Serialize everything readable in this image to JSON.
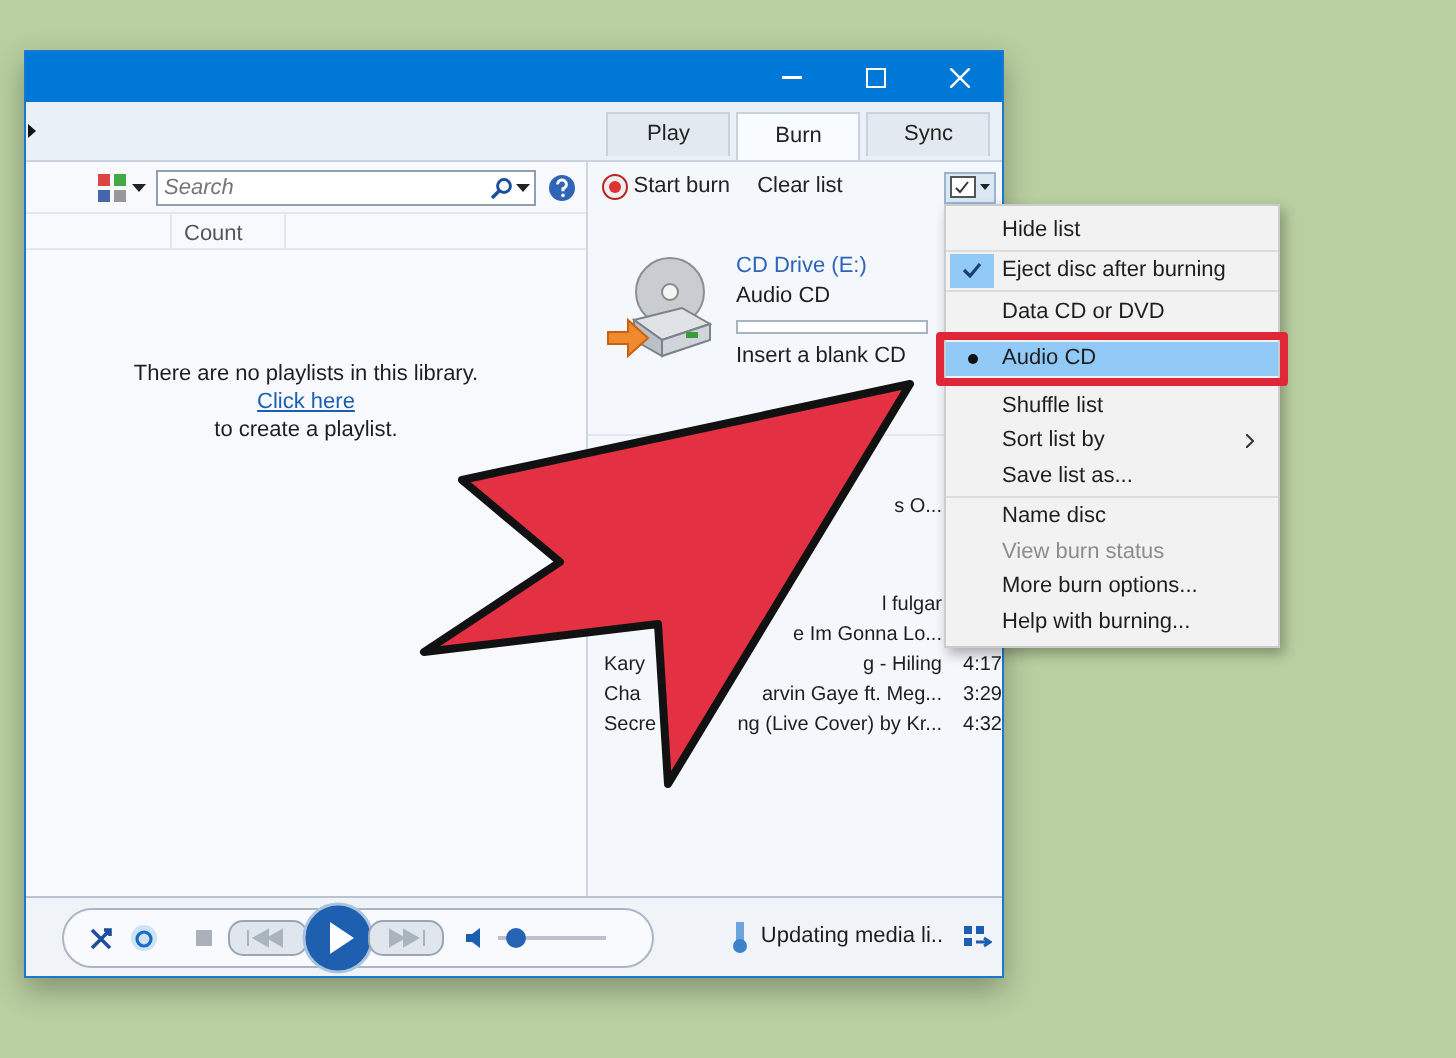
{
  "tabs": [
    {
      "label": "Play",
      "selected": false
    },
    {
      "label": "Burn",
      "selected": true
    },
    {
      "label": "Sync",
      "selected": false
    }
  ],
  "search": {
    "placeholder": "Search"
  },
  "library": {
    "columns": [
      "Count"
    ],
    "message": "There are no playlists in this library.",
    "link": "Click here",
    "after_link": "to create a playlist."
  },
  "burn_toolbar": {
    "start": "Start burn",
    "clear": "Clear list"
  },
  "drive": {
    "name": "CD Drive (E:)",
    "type": "Audio CD",
    "level": 0,
    "hint": "Insert a blank CD"
  },
  "tracks": [
    {
      "end": "s O..."
    },
    {
      "end": "l fulgar"
    },
    {
      "end": "e Im Gonna Lo..."
    },
    {
      "start": "Kary",
      "end": "g - Hiling",
      "duration": "4:17"
    },
    {
      "start": "Cha",
      "end": "arvin Gaye ft. Meg...",
      "duration": "3:29"
    },
    {
      "start": "Secre",
      "end": "ng (Live Cover) by Kr...",
      "duration": "4:32"
    }
  ],
  "player": {
    "volume": {
      "level": 0.1
    },
    "status": "Updating media li.."
  },
  "menu": {
    "groups": [
      [
        {
          "label": "Hide list",
          "kind": "item"
        }
      ],
      [
        {
          "label": "Eject disc after burning",
          "kind": "check",
          "checked": true
        }
      ],
      [
        {
          "label": "Data CD or DVD",
          "kind": "radio",
          "selected": false
        },
        {
          "label": "Audio CD",
          "kind": "radio",
          "selected": true,
          "highlighted": true,
          "framed": true
        },
        {
          "label": "Shuffle list",
          "kind": "item"
        },
        {
          "label": "Sort list by",
          "kind": "submenu"
        },
        {
          "label": "Save list as...",
          "kind": "item"
        }
      ],
      [
        {
          "label": "Name disc",
          "kind": "item"
        },
        {
          "label": "View burn status",
          "kind": "item",
          "disabled": true
        },
        {
          "label": "More burn options...",
          "kind": "item"
        },
        {
          "label": "Help with burning...",
          "kind": "item"
        }
      ]
    ]
  }
}
